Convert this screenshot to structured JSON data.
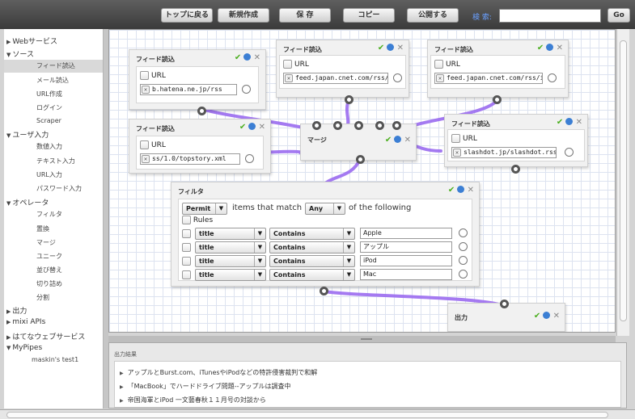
{
  "toolbar": {
    "back_label": "トップに戻る",
    "new_label": "新規作成",
    "save_label": "保 存",
    "copy_label": "コピー",
    "publish_label": "公開する",
    "search_label": "検 索:",
    "search_value": "",
    "go_label": "Go"
  },
  "sidebar": {
    "cat_web": "Webサービス",
    "cat_source": "ソース",
    "source_items": [
      "フィード読込",
      "メール読込",
      "URL作成",
      "ログイン",
      "Scraper"
    ],
    "cat_userinput": "ユーザ入力",
    "userinput_items": [
      "数値入力",
      "テキスト入力",
      "URL入力",
      "パスワード入力"
    ],
    "cat_operator": "オペレータ",
    "operator_items": [
      "フィルタ",
      "置換",
      "マージ",
      "ユニーク",
      "並び替え",
      "切り詰め",
      "分割"
    ],
    "cat_output": "出力",
    "cat_mixi": "mixi APIs",
    "cat_hatena": "はてなウェブサービス",
    "cat_mypipes": "MyPipes",
    "mypipes_items": [
      "maskin's test1"
    ]
  },
  "modules": {
    "feed1": {
      "title": "フィード読込",
      "url_label": "URL",
      "url_value": "b.hatena.ne.jp/rss"
    },
    "feed2": {
      "title": "フィード読込",
      "url_label": "URL",
      "url_value": "feed.japan.cnet.com/rss/i"
    },
    "feed3": {
      "title": "フィード読込",
      "url_label": "URL",
      "url_value": "feed.japan.cnet.com/rss/i"
    },
    "feed4": {
      "title": "フィード読込",
      "url_label": "URL",
      "url_value": "ss/1.0/topstory.xml"
    },
    "feed5": {
      "title": "フィード読込",
      "url_label": "URL",
      "url_value": "slashdot.jp/slashdot.rss"
    },
    "merge": {
      "title": "マージ"
    },
    "filter": {
      "title": "フィルタ",
      "mode": "Permit",
      "text_items_match": "items that match",
      "match": "Any",
      "text_following": "of the following",
      "rules_label": "Rules",
      "rules": [
        {
          "field": "title",
          "op": "Contains",
          "value": "Apple"
        },
        {
          "field": "title",
          "op": "Contains",
          "value": "アップル"
        },
        {
          "field": "title",
          "op": "Contains",
          "value": "iPod"
        },
        {
          "field": "title",
          "op": "Contains",
          "value": "Mac"
        }
      ]
    },
    "output": {
      "title": "出力"
    }
  },
  "output_panel": {
    "label": "出力結果",
    "items": [
      "アップルとBurst.com、iTunesやiPodなどの特許侵害裁判で和解",
      "「MacBook」でハードドライブ問題--アップルは調査中",
      "帝国海軍とiPod 一文藝春秋１１月号の対談から"
    ]
  },
  "colors": {
    "wire": "#9b6cf0",
    "accent_ok": "#4caf20",
    "info": "#3c7fd4"
  }
}
